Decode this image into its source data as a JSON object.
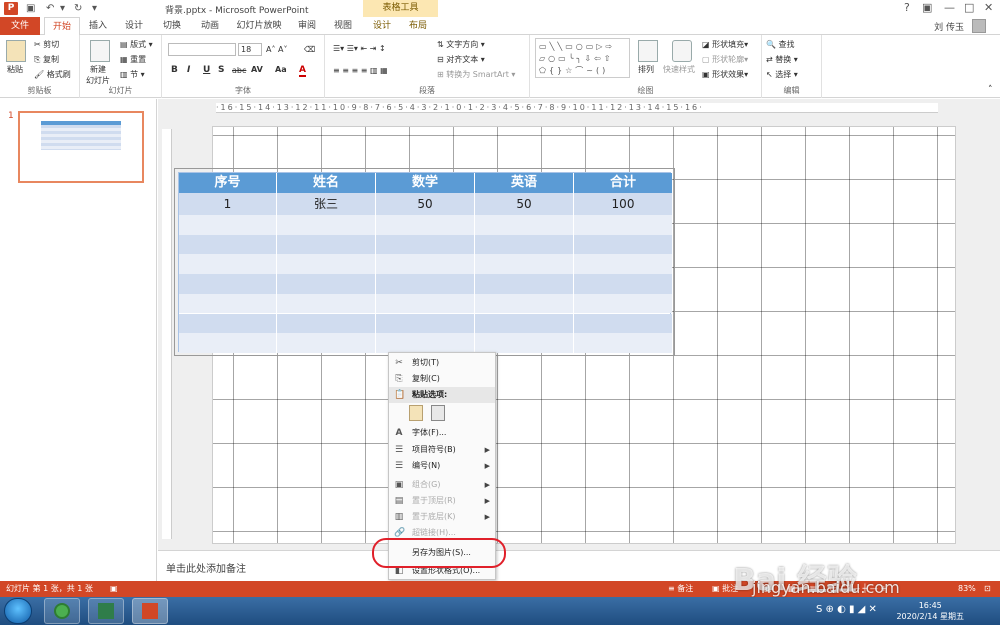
{
  "title_bar": {
    "logo": "P",
    "title": "背景.pptx - Microsoft PowerPoint",
    "table_tools": "表格工具",
    "help": "?",
    "minimize": "—",
    "restore": "□",
    "close": "✕"
  },
  "tabs": [
    "文件",
    "开始",
    "插入",
    "设计",
    "切换",
    "动画",
    "幻灯片放映",
    "审阅",
    "视图",
    "设计",
    "布局"
  ],
  "user": {
    "name": "刘 传玉"
  },
  "ribbon": {
    "clipboard": {
      "label": "剪贴板",
      "paste": "粘贴",
      "cut": "剪切",
      "copy": "复制",
      "format_painter": "格式刷"
    },
    "slides": {
      "label": "幻灯片",
      "new_slide": "新建\n幻灯片",
      "layout": "版式",
      "reset": "重置",
      "section": "节"
    },
    "font": {
      "label": "字体",
      "font_name": "",
      "font_size": "18",
      "bold": "B",
      "italic": "I",
      "underline": "U",
      "shadow": "S",
      "strike": "abc",
      "spacing": "AV",
      "case": "Aa",
      "color": "A"
    },
    "paragraph": {
      "label": "段落",
      "text_direction": "文字方向",
      "align_text": "对齐文本",
      "smartart": "转换为 SmartArt"
    },
    "drawing": {
      "label": "绘图",
      "arrange": "排列",
      "quick_styles": "快速样式",
      "shape_fill": "形状填充",
      "shape_outline": "形状轮廓",
      "shape_effects": "形状效果"
    },
    "editing": {
      "label": "编辑",
      "find": "查找",
      "replace": "替换",
      "select": "选择"
    }
  },
  "thumbnail": {
    "number": "1"
  },
  "ruler": {
    "h": "·16·15·14·13·12·11·10·9·8·7·6·5·4·3·2·1·0·1·2·3·4·5·6·7·8·9·10·11·12·13·14·15·16·"
  },
  "table": {
    "headers": [
      "序号",
      "姓名",
      "数学",
      "英语",
      "合计"
    ],
    "rows": [
      [
        "1",
        "张三",
        "50",
        "50",
        "100"
      ]
    ],
    "empty_rows": 7
  },
  "context_menu": {
    "items": [
      {
        "label": "剪切(T)",
        "icon": "✂",
        "disabled": false
      },
      {
        "label": "复制(C)",
        "icon": "⎘",
        "disabled": false
      },
      {
        "label": "粘贴选项:",
        "icon": "📋",
        "disabled": false
      },
      {
        "label": "字体(F)...",
        "icon": "A",
        "disabled": false
      },
      {
        "label": "项目符号(B)",
        "icon": "☰",
        "disabled": false
      },
      {
        "label": "编号(N)",
        "icon": "☰",
        "disabled": false
      },
      {
        "label": "组合(G)",
        "icon": "▣",
        "disabled": true
      },
      {
        "label": "置于顶层(R)",
        "icon": "▤",
        "disabled": true
      },
      {
        "label": "置于底层(K)",
        "icon": "▥",
        "disabled": true
      },
      {
        "label": "超链接(H)...",
        "icon": "🔗",
        "disabled": true
      },
      {
        "label": "另存为图片(S)...",
        "icon": "",
        "disabled": false
      },
      {
        "label": "设置形状格式(O)...",
        "icon": "◧",
        "disabled": false
      }
    ]
  },
  "notes": {
    "placeholder": "单击此处添加备注"
  },
  "status": {
    "slide_info": "幻灯片 第 1 张，共 1 张",
    "notes": "备注",
    "comments": "批注",
    "zoom": "83%"
  },
  "taskbar": {
    "time": "16:45",
    "date": "2020/2/14 星期五"
  },
  "watermark": {
    "brand": "Bai 经验",
    "url": "jingyan.baidu.com"
  },
  "colors": {
    "accent": "#D24726",
    "table_header": "#5B9BD5",
    "table_band": "#D0DCEF",
    "table_light": "#E9EEF7"
  }
}
